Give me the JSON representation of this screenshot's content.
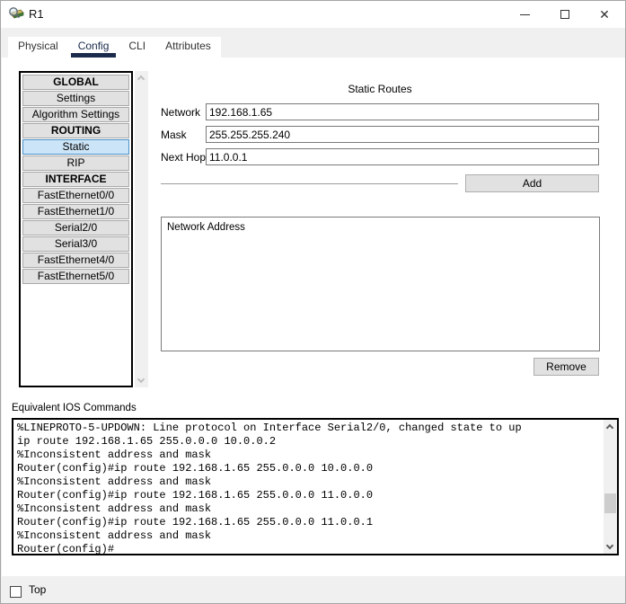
{
  "window": {
    "title": "R1",
    "icons": {
      "app": "router-magnifier-icon",
      "minimize": "minimize-icon",
      "maximize": "maximize-icon",
      "close": "close-icon"
    },
    "close_glyph": "✕"
  },
  "tabs": [
    {
      "label": "Physical",
      "active": false
    },
    {
      "label": "Config",
      "active": true
    },
    {
      "label": "CLI",
      "active": false
    },
    {
      "label": "Attributes",
      "active": false
    }
  ],
  "sidebar": {
    "items": [
      {
        "label": "GLOBAL",
        "type": "header",
        "selected": false
      },
      {
        "label": "Settings",
        "type": "button",
        "selected": false
      },
      {
        "label": "Algorithm Settings",
        "type": "button",
        "selected": false
      },
      {
        "label": "ROUTING",
        "type": "header",
        "selected": false
      },
      {
        "label": "Static",
        "type": "button",
        "selected": true
      },
      {
        "label": "RIP",
        "type": "button",
        "selected": false
      },
      {
        "label": "INTERFACE",
        "type": "header",
        "selected": false
      },
      {
        "label": "FastEthernet0/0",
        "type": "button",
        "selected": false
      },
      {
        "label": "FastEthernet1/0",
        "type": "button",
        "selected": false
      },
      {
        "label": "Serial2/0",
        "type": "button",
        "selected": false
      },
      {
        "label": "Serial3/0",
        "type": "button",
        "selected": false
      },
      {
        "label": "FastEthernet4/0",
        "type": "button",
        "selected": false
      },
      {
        "label": "FastEthernet5/0",
        "type": "button",
        "selected": false
      }
    ]
  },
  "static_routes": {
    "title": "Static Routes",
    "fields": [
      {
        "label": "Network",
        "value": "192.168.1.65"
      },
      {
        "label": "Mask",
        "value": "255.255.255.240"
      },
      {
        "label": "Next Hop",
        "value": "11.0.0.1"
      }
    ],
    "add_label": "Add",
    "list_header": "Network Address",
    "list_items": [],
    "remove_label": "Remove"
  },
  "ios": {
    "label": "Equivalent IOS Commands",
    "lines": [
      "%LINEPROTO-5-UPDOWN: Line protocol on Interface Serial2/0, changed state to up",
      "ip route 192.168.1.65 255.0.0.0 10.0.0.2",
      "%Inconsistent address and mask",
      "Router(config)#ip route 192.168.1.65 255.0.0.0 10.0.0.0",
      "%Inconsistent address and mask",
      "Router(config)#ip route 192.168.1.65 255.0.0.0 11.0.0.0",
      "%Inconsistent address and mask",
      "Router(config)#ip route 192.168.1.65 255.0.0.0 11.0.0.1",
      "%Inconsistent address and mask",
      "Router(config)#"
    ]
  },
  "footer": {
    "top_label": "Top",
    "checked": false
  },
  "colors": {
    "selected_bg": "#cce4f7",
    "selected_border": "#4a90c4",
    "tab_underline": "#1b2b4b",
    "button_bg": "#e1e1e1"
  }
}
